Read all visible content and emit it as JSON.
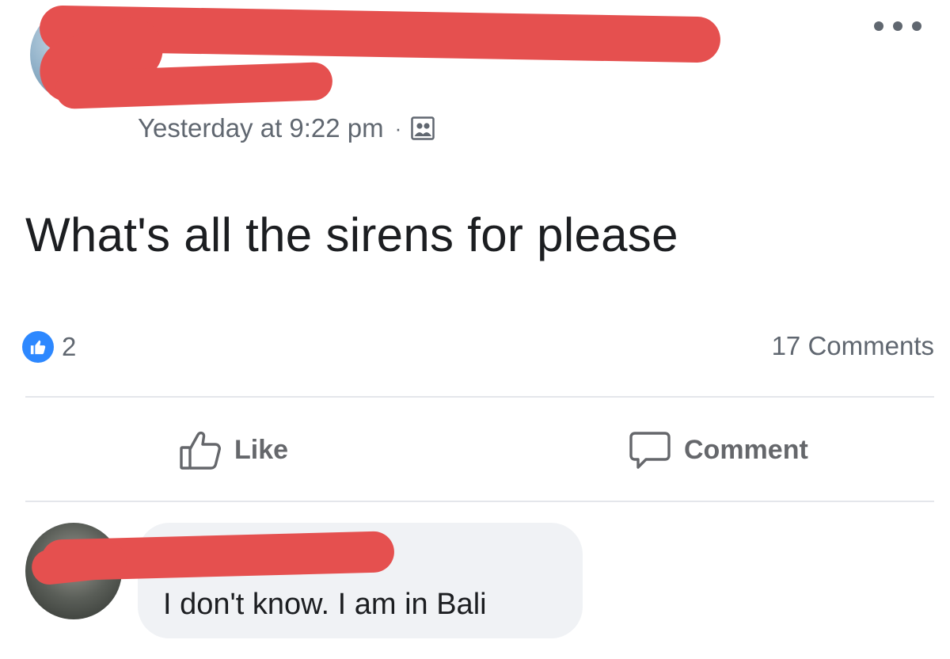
{
  "post": {
    "author_name": "",
    "timestamp": "Yesterday at 9:22 pm",
    "separator": "·",
    "audience_icon": "friends-icon",
    "text": "What's all the sirens for please",
    "like_count": "2",
    "comment_count": "17 Comments"
  },
  "actions": {
    "like_label": "Like",
    "comment_label": "Comment"
  },
  "comment": {
    "author_name": "",
    "text": "I don't know. I am in Bali"
  },
  "colors": {
    "redaction": "#e5504f",
    "like_blue": "#2d88ff",
    "secondary_text": "#606770",
    "bubble_bg": "#f0f2f5"
  }
}
